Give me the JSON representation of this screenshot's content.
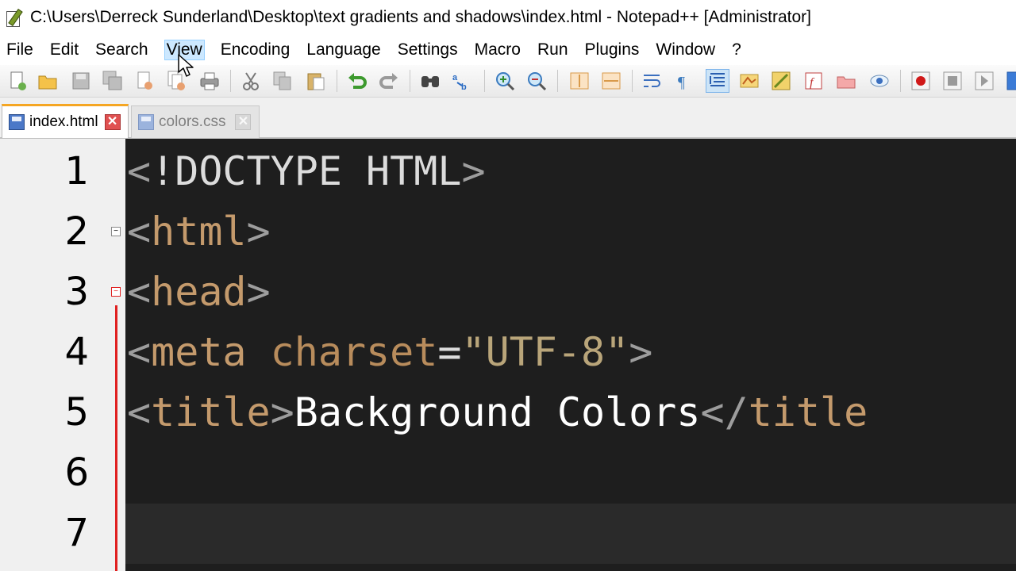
{
  "window": {
    "title": "C:\\Users\\Derreck Sunderland\\Desktop\\text gradients and shadows\\index.html - Notepad++ [Administrator]"
  },
  "menu": [
    "File",
    "Edit",
    "Search",
    "View",
    "Encoding",
    "Language",
    "Settings",
    "Macro",
    "Run",
    "Plugins",
    "Window",
    "?"
  ],
  "menu_hover": "View",
  "tabs": [
    {
      "label": "index.html",
      "active": true
    },
    {
      "label": "colors.css",
      "active": false
    }
  ],
  "editor": {
    "lines": [
      {
        "num": "1",
        "parts": [
          [
            "bracket",
            "<"
          ],
          [
            "doctype",
            "!DOCTYPE HTML"
          ],
          [
            "bracket",
            ">"
          ]
        ]
      },
      {
        "num": "2",
        "parts": [
          [
            "bracket",
            "<"
          ],
          [
            "tag",
            "html"
          ],
          [
            "bracket",
            ">"
          ]
        ]
      },
      {
        "num": "3",
        "parts": [
          [
            "bracket",
            "<"
          ],
          [
            "tag",
            "head"
          ],
          [
            "bracket",
            ">"
          ]
        ]
      },
      {
        "num": "4",
        "parts": [
          [
            "bracket",
            "<"
          ],
          [
            "tag",
            "meta"
          ],
          [
            "eq",
            " "
          ],
          [
            "attr",
            "charset"
          ],
          [
            "eq",
            "="
          ],
          [
            "str",
            "\"UTF-8\""
          ],
          [
            "bracket",
            ">"
          ]
        ]
      },
      {
        "num": "5",
        "parts": [
          [
            "bracket",
            "<"
          ],
          [
            "tag",
            "title"
          ],
          [
            "bracket",
            ">"
          ],
          [
            "text",
            "Background Colors"
          ],
          [
            "bracket",
            "</"
          ],
          [
            "tag",
            "title"
          ]
        ]
      },
      {
        "num": "6",
        "parts": []
      },
      {
        "num": "7",
        "parts": []
      }
    ]
  },
  "colors": {
    "editor_bg": "#1e1e1e",
    "tag": "#c49a6c",
    "string": "#b9a57a",
    "fold_marker": "#e02020",
    "active_tab_accent": "#f5a623"
  },
  "toolbar_icons": [
    "new-file-icon",
    "open-file-icon",
    "save-icon",
    "save-all-icon",
    "close-icon",
    "close-all-icon",
    "print-icon",
    "cut-icon",
    "copy-icon",
    "paste-icon",
    "undo-icon",
    "redo-icon",
    "find-icon",
    "replace-icon",
    "zoom-in-icon",
    "zoom-out-icon",
    "sync-vertical-icon",
    "sync-horizontal-icon",
    "word-wrap-icon",
    "show-all-chars-icon",
    "indent-guide-icon",
    "user-lang-icon",
    "doc-map-icon",
    "function-list-icon",
    "folder-workspace-icon",
    "monitoring-icon",
    "record-macro-icon",
    "stop-macro-icon",
    "play-macro-icon",
    "run-macro-icon"
  ]
}
